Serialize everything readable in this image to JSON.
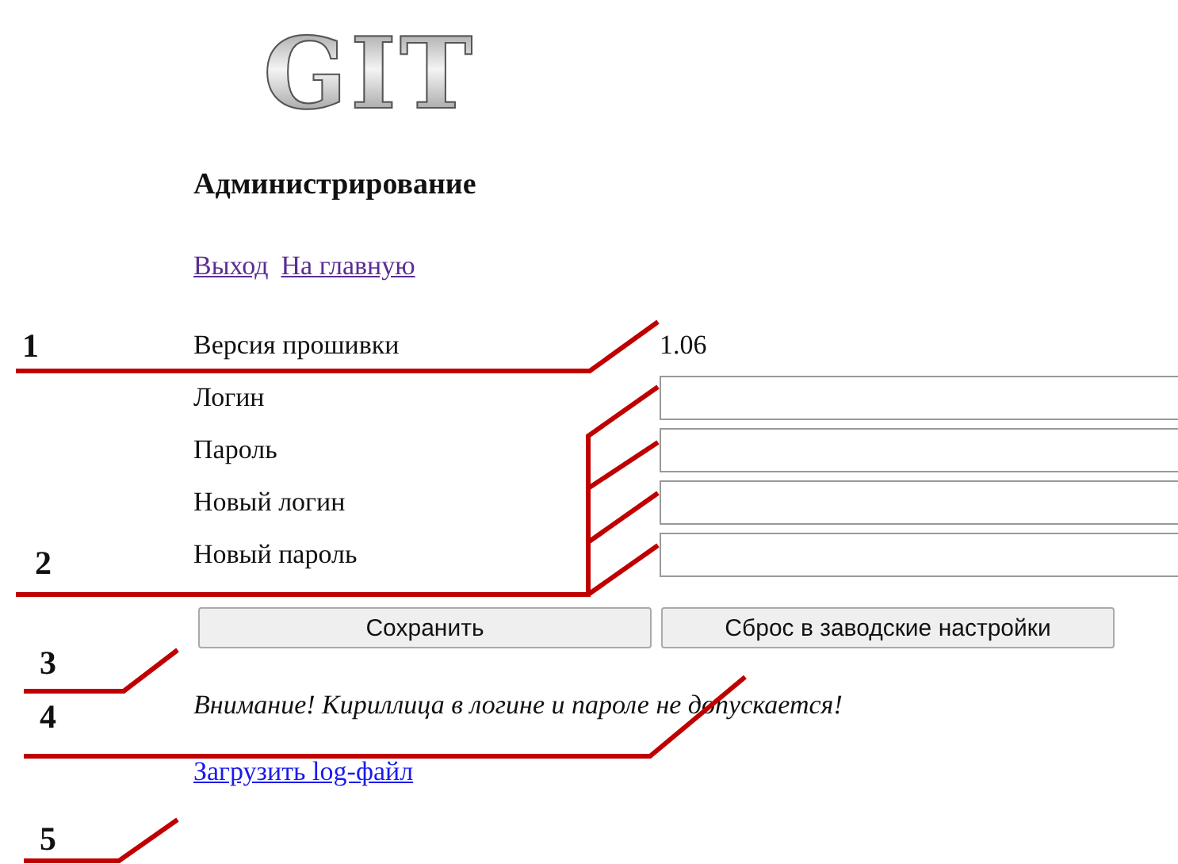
{
  "logo": {
    "text": "GIT"
  },
  "heading": "Администрирование",
  "nav_links": [
    "Выход",
    "На главную"
  ],
  "fields": [
    {
      "kind": "value",
      "label": "Версия прошивки",
      "value": "1.06"
    },
    {
      "kind": "input",
      "label": "Логин"
    },
    {
      "kind": "input",
      "label": "Пароль"
    },
    {
      "kind": "input",
      "label": "Новый логин"
    },
    {
      "kind": "input",
      "label": "Новый пароль"
    }
  ],
  "buttons": [
    "Сохранить",
    "Сброс в заводские настройки"
  ],
  "warning": "Внимание! Кириллица в логине и пароле не допускается!",
  "log_link": "Загрузить log-файл",
  "callouts": [
    {
      "number": "1"
    },
    {
      "number": "2"
    },
    {
      "number": "3"
    },
    {
      "number": "4"
    },
    {
      "number": "5"
    }
  ]
}
